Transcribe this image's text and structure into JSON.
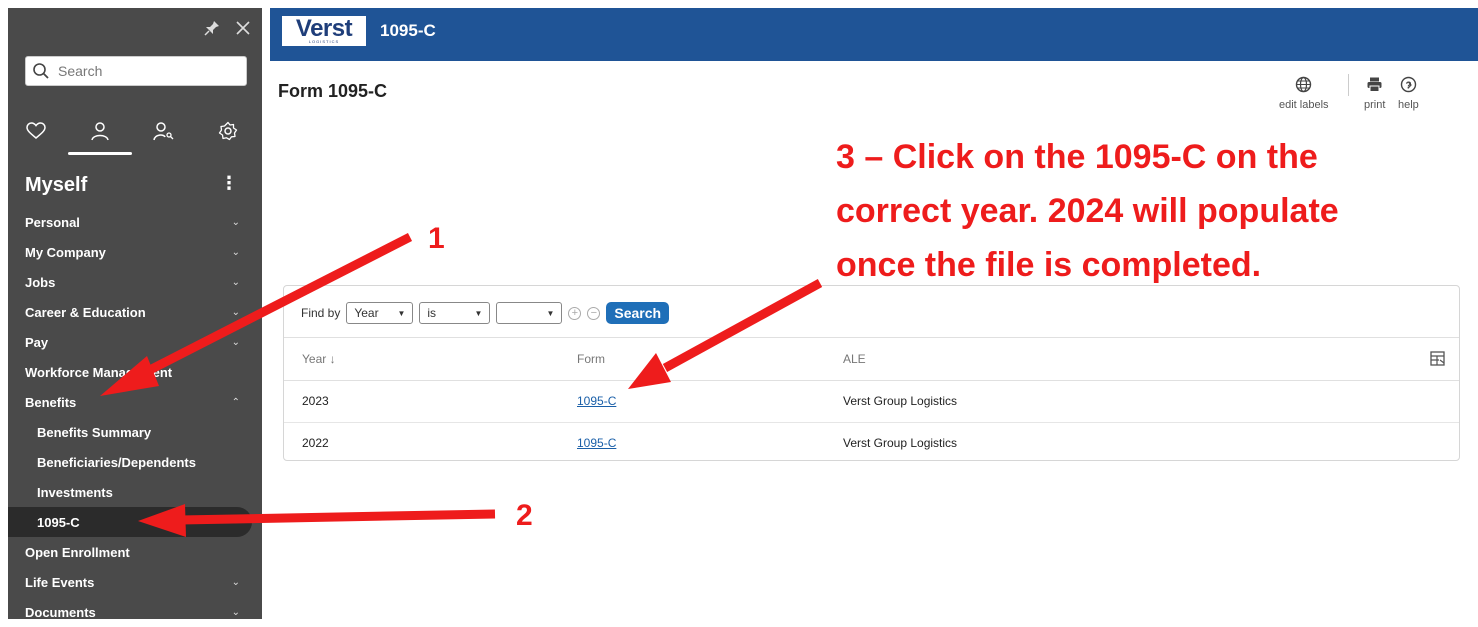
{
  "sidebar": {
    "search_placeholder": "Search",
    "section_title": "Myself",
    "items": [
      {
        "label": "Personal",
        "chevron": "⌄"
      },
      {
        "label": "My Company",
        "chevron": "⌄"
      },
      {
        "label": "Jobs",
        "chevron": "⌄"
      },
      {
        "label": "Career & Education",
        "chevron": "⌄"
      },
      {
        "label": "Pay",
        "chevron": "⌄"
      },
      {
        "label": "Workforce Management",
        "chevron": ""
      },
      {
        "label": "Benefits",
        "chevron": "⌃"
      },
      {
        "label": "Benefits Summary",
        "chevron": ""
      },
      {
        "label": "Beneficiaries/Dependents",
        "chevron": ""
      },
      {
        "label": "Investments",
        "chevron": ""
      },
      {
        "label": "1095-C",
        "chevron": ""
      },
      {
        "label": "Open Enrollment",
        "chevron": ""
      },
      {
        "label": "Life Events",
        "chevron": "⌄"
      },
      {
        "label": "Documents",
        "chevron": "⌄"
      }
    ]
  },
  "topbar": {
    "logo_text": "Verst",
    "logo_sub": "LOGISTICS",
    "title": "1095-C"
  },
  "page": {
    "title": "Form 1095-C",
    "toolbar": {
      "edit_labels": "edit labels",
      "print": "print",
      "help": "help"
    }
  },
  "filter": {
    "label": "Find by",
    "field": "Year",
    "operator": "is",
    "value": "",
    "search_button": "Search"
  },
  "table": {
    "headers": [
      "Year ↓",
      "Form",
      "ALE"
    ],
    "rows": [
      {
        "year": "2023",
        "form": "1095-C",
        "ale": "Verst Group Logistics"
      },
      {
        "year": "2022",
        "form": "1095-C",
        "ale": "Verst Group Logistics"
      }
    ]
  },
  "annotations": {
    "step1": "1",
    "step2": "2",
    "step3_lines": [
      "3 – Click on the 1095-C on the",
      "correct year.  2024 will populate",
      "once the file is completed."
    ],
    "color": "#ee1c1c"
  }
}
